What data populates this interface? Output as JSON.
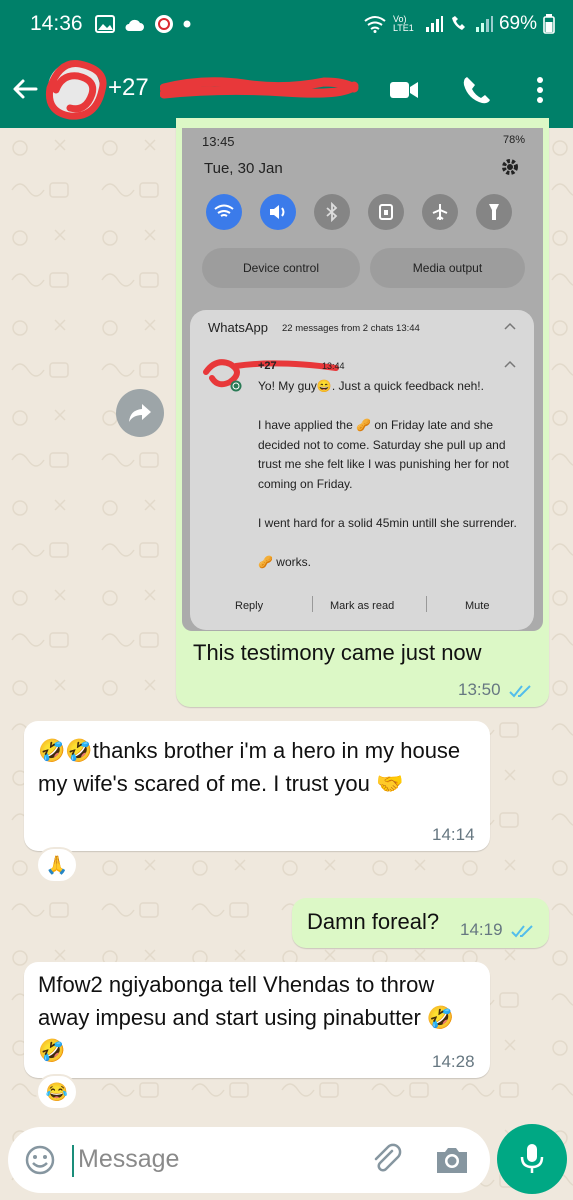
{
  "status_bar": {
    "time": "14:36",
    "battery": "69%",
    "network_label": "Vo) LTE1"
  },
  "header": {
    "contact_prefix": "+27"
  },
  "messages": [
    {
      "type": "image",
      "direction": "outgoing",
      "caption": "This testimony came just now",
      "time": "13:50",
      "screenshot": {
        "time": "13:45",
        "battery": "78%",
        "date": "Tue, 30 Jan",
        "device_control": "Device control",
        "media_output": "Media output",
        "notification": {
          "app": "WhatsApp",
          "meta": "22 messages from 2 chats  13:44",
          "sender_prefix": "+27",
          "time": "13:44",
          "body": "Yo! My guy😄. Just a quick feedback neh!.\n\nI have applied the 🥜 on Friday late and she decided not to come. Saturday she pull up and trust me she felt like I was punishing her for not coming on Friday.\n\nI went hard for a solid 45min untill she surrender.\n\n🥜 works.",
          "actions": [
            "Reply",
            "Mark as read",
            "Mute"
          ]
        }
      }
    },
    {
      "type": "text",
      "direction": "incoming",
      "text": "🤣🤣thanks brother i'm a hero in my house my wife's scared of me. I trust you 🤝",
      "time": "14:14",
      "reaction": "🙏"
    },
    {
      "type": "text",
      "direction": "outgoing",
      "text": "Damn foreal?",
      "time": "14:19"
    },
    {
      "type": "text",
      "direction": "incoming",
      "text": "Mfow2 ngiyabonga tell Vhendas to throw away impesu and start using pinabutter 🤣🤣",
      "time": "14:28",
      "reaction": "😂"
    }
  ],
  "input": {
    "placeholder": "Message"
  },
  "colors": {
    "header": "#008069",
    "outgoing_bubble": "#dcf8c6",
    "incoming_bubble": "#ffffff",
    "read_ticks": "#53bdeb",
    "mic_button": "#00a884"
  },
  "icons": [
    "back-arrow-icon",
    "video-call-icon",
    "phone-icon",
    "menu-dots-icon",
    "forward-icon",
    "emoji-icon",
    "attach-icon",
    "camera-icon",
    "mic-icon"
  ]
}
